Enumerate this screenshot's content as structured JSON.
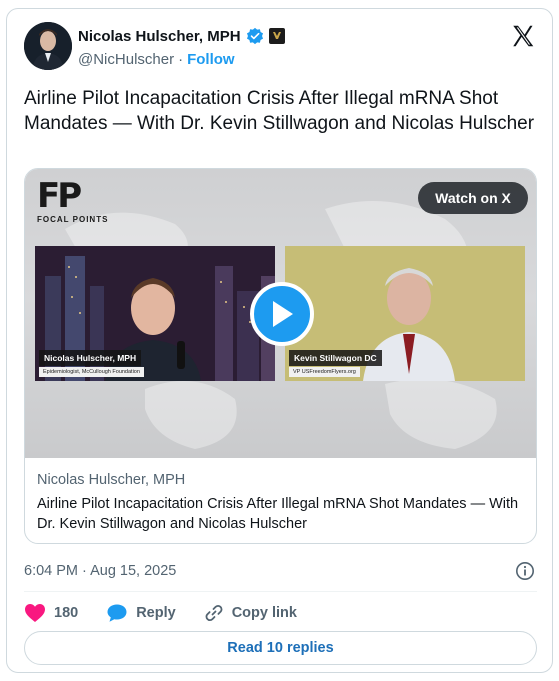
{
  "author": {
    "display_name": "Nicolas Hulscher, MPH",
    "handle": "@NicHulscher",
    "separator": "·",
    "follow_label": "Follow"
  },
  "tweet": {
    "text": "Airline Pilot Incapacitation Crisis After Illegal mRNA Shot Mandates — With Dr. Kevin Stillwagon and Nicolas Hulscher",
    "timestamp": "6:04 PM · Aug 15, 2025"
  },
  "media": {
    "logo_letters": "FP",
    "logo_sub": "FOCAL POINTS",
    "watch_label": "Watch on X",
    "left_speaker_name": "Nicolas Hulscher, MPH",
    "left_speaker_title": "Epidemiologist, McCullough Foundation",
    "right_speaker_name": "Kevin Stillwagon DC",
    "right_speaker_title": "VP USFreedomFlyers.org"
  },
  "card": {
    "source": "Nicolas Hulscher, MPH",
    "title": "Airline Pilot Incapacitation Crisis After Illegal mRNA Shot Mandates — With Dr. Kevin Stillwagon and Nicolas Hulscher"
  },
  "actions": {
    "likes": "180",
    "reply_label": "Reply",
    "copy_link_label": "Copy link",
    "read_replies_label": "Read 10 replies"
  },
  "colors": {
    "accent": "#1d9bf0",
    "like": "#f91880",
    "text": "#0f1419",
    "muted": "#536471"
  },
  "icons": [
    "verified-badge-icon",
    "affiliation-badge-icon",
    "x-logo-icon",
    "play-icon",
    "info-icon",
    "heart-icon",
    "reply-bubble-icon",
    "link-icon"
  ]
}
